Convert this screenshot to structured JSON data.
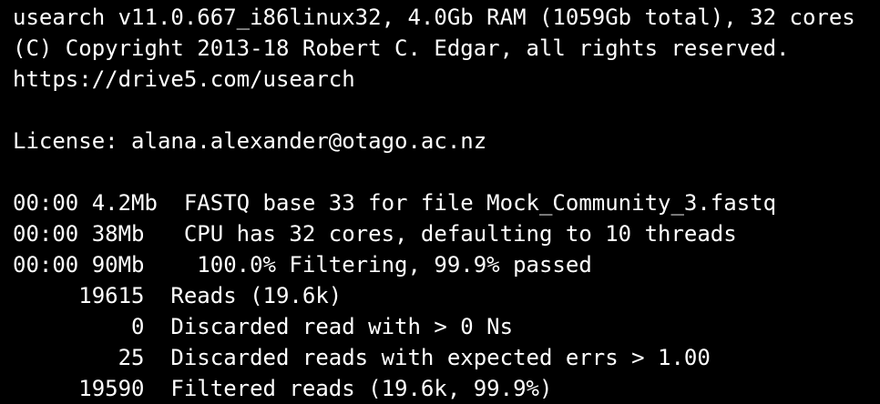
{
  "terminal": {
    "background": "#000000",
    "foreground": "#ffffff",
    "lines": [
      "usearch v11.0.667_i86linux32, 4.0Gb RAM (1059Gb total), 32 cores",
      "(C) Copyright 2013-18 Robert C. Edgar, all rights reserved.",
      "https://drive5.com/usearch",
      "",
      "License: alana.alexander@otago.ac.nz",
      "",
      "00:00 4.2Mb  FASTQ base 33 for file Mock_Community_3.fastq",
      "00:00 38Mb   CPU has 32 cores, defaulting to 10 threads",
      "00:00 90Mb    100.0% Filtering, 99.9% passed",
      "     19615  Reads (19.6k)",
      "         0  Discarded read with > 0 Ns",
      "        25  Discarded reads with expected errs > 1.00",
      "     19590  Filtered reads (19.6k, 99.9%)"
    ]
  }
}
